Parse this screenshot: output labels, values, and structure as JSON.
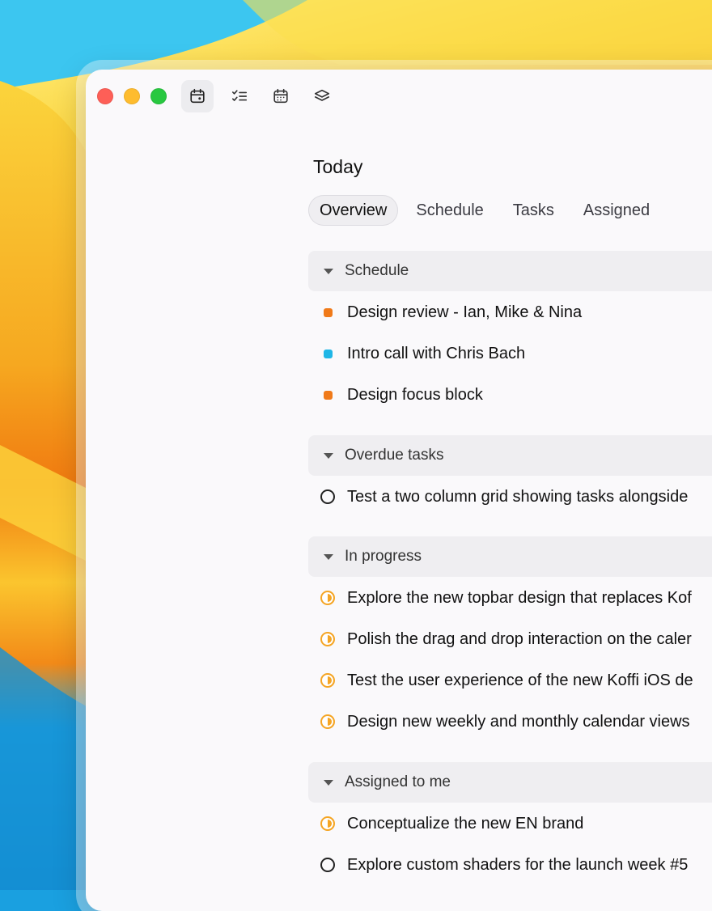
{
  "toolbar": {
    "window_controls": [
      "close",
      "minimize",
      "maximize"
    ],
    "buttons": [
      {
        "icon": "calendar-today-icon",
        "active": true
      },
      {
        "icon": "checklist-icon",
        "active": false
      },
      {
        "icon": "calendar-icon",
        "active": false
      },
      {
        "icon": "layers-icon",
        "active": false
      }
    ]
  },
  "main": {
    "title": "Today",
    "tabs": [
      {
        "label": "Overview",
        "active": true
      },
      {
        "label": "Schedule",
        "active": false
      },
      {
        "label": "Tasks",
        "active": false
      },
      {
        "label": "Assigned",
        "active": false
      }
    ],
    "sections": [
      {
        "label": "Schedule",
        "items": [
          {
            "text": "Design review - Ian, Mike & Nina",
            "marker": "dot",
            "color": "#f07a19"
          },
          {
            "text": "Intro call with Chris Bach",
            "marker": "dot",
            "color": "#1fb6e6"
          },
          {
            "text": "Design focus block",
            "marker": "dot",
            "color": "#f07a19"
          }
        ]
      },
      {
        "label": "Overdue tasks",
        "items": [
          {
            "text": "Test a two column grid showing tasks alongside",
            "marker": "circle"
          }
        ]
      },
      {
        "label": "In progress",
        "items": [
          {
            "text": "Explore the new topbar design that replaces Kof",
            "marker": "half-circle"
          },
          {
            "text": "Polish the drag and drop interaction on the caler",
            "marker": "half-circle"
          },
          {
            "text": "Test the user experience of the new Koffi iOS de",
            "marker": "half-circle"
          },
          {
            "text": "Design new weekly and monthly calendar views",
            "marker": "half-circle"
          }
        ]
      },
      {
        "label": "Assigned to me",
        "items": [
          {
            "text": "Conceptualize the new EN brand",
            "marker": "half-circle"
          },
          {
            "text": "Explore custom shaders for the launch week #5",
            "marker": "circle"
          }
        ]
      }
    ]
  },
  "colors": {
    "accent_in_progress": "#f5a524",
    "schedule_orange": "#f07a19",
    "schedule_blue": "#1fb6e6",
    "window_bg": "#faf9fb",
    "section_bg": "#efeef1"
  }
}
